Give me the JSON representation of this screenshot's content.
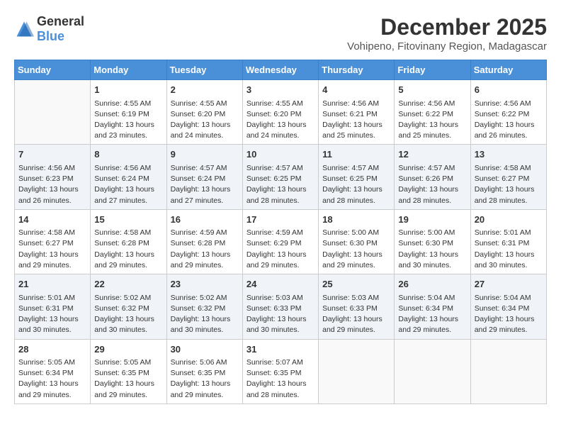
{
  "logo": {
    "general": "General",
    "blue": "Blue"
  },
  "header": {
    "title": "December 2025",
    "subtitle": "Vohipeno, Fitovinany Region, Madagascar"
  },
  "weekdays": [
    "Sunday",
    "Monday",
    "Tuesday",
    "Wednesday",
    "Thursday",
    "Friday",
    "Saturday"
  ],
  "weeks": [
    [
      {
        "day": "",
        "sunrise": "",
        "sunset": "",
        "daylight": ""
      },
      {
        "day": "1",
        "sunrise": "Sunrise: 4:55 AM",
        "sunset": "Sunset: 6:19 PM",
        "daylight": "Daylight: 13 hours and 23 minutes."
      },
      {
        "day": "2",
        "sunrise": "Sunrise: 4:55 AM",
        "sunset": "Sunset: 6:20 PM",
        "daylight": "Daylight: 13 hours and 24 minutes."
      },
      {
        "day": "3",
        "sunrise": "Sunrise: 4:55 AM",
        "sunset": "Sunset: 6:20 PM",
        "daylight": "Daylight: 13 hours and 24 minutes."
      },
      {
        "day": "4",
        "sunrise": "Sunrise: 4:56 AM",
        "sunset": "Sunset: 6:21 PM",
        "daylight": "Daylight: 13 hours and 25 minutes."
      },
      {
        "day": "5",
        "sunrise": "Sunrise: 4:56 AM",
        "sunset": "Sunset: 6:22 PM",
        "daylight": "Daylight: 13 hours and 25 minutes."
      },
      {
        "day": "6",
        "sunrise": "Sunrise: 4:56 AM",
        "sunset": "Sunset: 6:22 PM",
        "daylight": "Daylight: 13 hours and 26 minutes."
      }
    ],
    [
      {
        "day": "7",
        "sunrise": "Sunrise: 4:56 AM",
        "sunset": "Sunset: 6:23 PM",
        "daylight": "Daylight: 13 hours and 26 minutes."
      },
      {
        "day": "8",
        "sunrise": "Sunrise: 4:56 AM",
        "sunset": "Sunset: 6:24 PM",
        "daylight": "Daylight: 13 hours and 27 minutes."
      },
      {
        "day": "9",
        "sunrise": "Sunrise: 4:57 AM",
        "sunset": "Sunset: 6:24 PM",
        "daylight": "Daylight: 13 hours and 27 minutes."
      },
      {
        "day": "10",
        "sunrise": "Sunrise: 4:57 AM",
        "sunset": "Sunset: 6:25 PM",
        "daylight": "Daylight: 13 hours and 28 minutes."
      },
      {
        "day": "11",
        "sunrise": "Sunrise: 4:57 AM",
        "sunset": "Sunset: 6:25 PM",
        "daylight": "Daylight: 13 hours and 28 minutes."
      },
      {
        "day": "12",
        "sunrise": "Sunrise: 4:57 AM",
        "sunset": "Sunset: 6:26 PM",
        "daylight": "Daylight: 13 hours and 28 minutes."
      },
      {
        "day": "13",
        "sunrise": "Sunrise: 4:58 AM",
        "sunset": "Sunset: 6:27 PM",
        "daylight": "Daylight: 13 hours and 28 minutes."
      }
    ],
    [
      {
        "day": "14",
        "sunrise": "Sunrise: 4:58 AM",
        "sunset": "Sunset: 6:27 PM",
        "daylight": "Daylight: 13 hours and 29 minutes."
      },
      {
        "day": "15",
        "sunrise": "Sunrise: 4:58 AM",
        "sunset": "Sunset: 6:28 PM",
        "daylight": "Daylight: 13 hours and 29 minutes."
      },
      {
        "day": "16",
        "sunrise": "Sunrise: 4:59 AM",
        "sunset": "Sunset: 6:28 PM",
        "daylight": "Daylight: 13 hours and 29 minutes."
      },
      {
        "day": "17",
        "sunrise": "Sunrise: 4:59 AM",
        "sunset": "Sunset: 6:29 PM",
        "daylight": "Daylight: 13 hours and 29 minutes."
      },
      {
        "day": "18",
        "sunrise": "Sunrise: 5:00 AM",
        "sunset": "Sunset: 6:30 PM",
        "daylight": "Daylight: 13 hours and 29 minutes."
      },
      {
        "day": "19",
        "sunrise": "Sunrise: 5:00 AM",
        "sunset": "Sunset: 6:30 PM",
        "daylight": "Daylight: 13 hours and 30 minutes."
      },
      {
        "day": "20",
        "sunrise": "Sunrise: 5:01 AM",
        "sunset": "Sunset: 6:31 PM",
        "daylight": "Daylight: 13 hours and 30 minutes."
      }
    ],
    [
      {
        "day": "21",
        "sunrise": "Sunrise: 5:01 AM",
        "sunset": "Sunset: 6:31 PM",
        "daylight": "Daylight: 13 hours and 30 minutes."
      },
      {
        "day": "22",
        "sunrise": "Sunrise: 5:02 AM",
        "sunset": "Sunset: 6:32 PM",
        "daylight": "Daylight: 13 hours and 30 minutes."
      },
      {
        "day": "23",
        "sunrise": "Sunrise: 5:02 AM",
        "sunset": "Sunset: 6:32 PM",
        "daylight": "Daylight: 13 hours and 30 minutes."
      },
      {
        "day": "24",
        "sunrise": "Sunrise: 5:03 AM",
        "sunset": "Sunset: 6:33 PM",
        "daylight": "Daylight: 13 hours and 30 minutes."
      },
      {
        "day": "25",
        "sunrise": "Sunrise: 5:03 AM",
        "sunset": "Sunset: 6:33 PM",
        "daylight": "Daylight: 13 hours and 29 minutes."
      },
      {
        "day": "26",
        "sunrise": "Sunrise: 5:04 AM",
        "sunset": "Sunset: 6:34 PM",
        "daylight": "Daylight: 13 hours and 29 minutes."
      },
      {
        "day": "27",
        "sunrise": "Sunrise: 5:04 AM",
        "sunset": "Sunset: 6:34 PM",
        "daylight": "Daylight: 13 hours and 29 minutes."
      }
    ],
    [
      {
        "day": "28",
        "sunrise": "Sunrise: 5:05 AM",
        "sunset": "Sunset: 6:34 PM",
        "daylight": "Daylight: 13 hours and 29 minutes."
      },
      {
        "day": "29",
        "sunrise": "Sunrise: 5:05 AM",
        "sunset": "Sunset: 6:35 PM",
        "daylight": "Daylight: 13 hours and 29 minutes."
      },
      {
        "day": "30",
        "sunrise": "Sunrise: 5:06 AM",
        "sunset": "Sunset: 6:35 PM",
        "daylight": "Daylight: 13 hours and 29 minutes."
      },
      {
        "day": "31",
        "sunrise": "Sunrise: 5:07 AM",
        "sunset": "Sunset: 6:35 PM",
        "daylight": "Daylight: 13 hours and 28 minutes."
      },
      {
        "day": "",
        "sunrise": "",
        "sunset": "",
        "daylight": ""
      },
      {
        "day": "",
        "sunrise": "",
        "sunset": "",
        "daylight": ""
      },
      {
        "day": "",
        "sunrise": "",
        "sunset": "",
        "daylight": ""
      }
    ]
  ]
}
